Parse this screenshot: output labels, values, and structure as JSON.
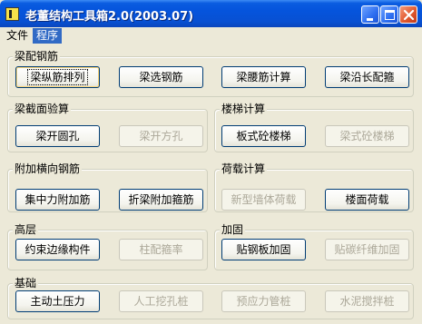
{
  "window": {
    "title": "老董结构工具箱2.0(2003.07)",
    "icon": "app-icon",
    "controls": [
      "minimize-icon",
      "maximize-icon",
      "close-icon"
    ]
  },
  "menu": {
    "file": "文件",
    "program": "程序"
  },
  "groups": {
    "reinforcement": {
      "title": "梁配钢筋",
      "buttons": [
        "梁纵筋排列",
        "梁选钢筋",
        "梁腰筋计算",
        "梁沿长配箍"
      ]
    },
    "section_check": {
      "title": "梁截面验算",
      "buttons": [
        "梁开圆孔",
        "梁开方孔"
      ]
    },
    "stairs": {
      "title": "楼梯计算",
      "buttons": [
        "板式砼楼梯",
        "梁式砼楼梯"
      ]
    },
    "transverse": {
      "title": "附加横向钢筋",
      "buttons": [
        "集中力附加筋",
        "折梁附加箍筋"
      ]
    },
    "loads": {
      "title": "荷载计算",
      "buttons": [
        "新型墙体荷载",
        "楼面荷载"
      ]
    },
    "highrise": {
      "title": "高层",
      "buttons": [
        "约束边缘构件",
        "柱配箍率"
      ]
    },
    "strengthen": {
      "title": "加固",
      "buttons": [
        "贴钢板加固",
        "贴碳纤维加固"
      ]
    },
    "foundation": {
      "title": "基础",
      "buttons": [
        "主动土压力",
        "人工挖孔桩",
        "预应力管桩",
        "水泥搅拌桩"
      ]
    }
  }
}
